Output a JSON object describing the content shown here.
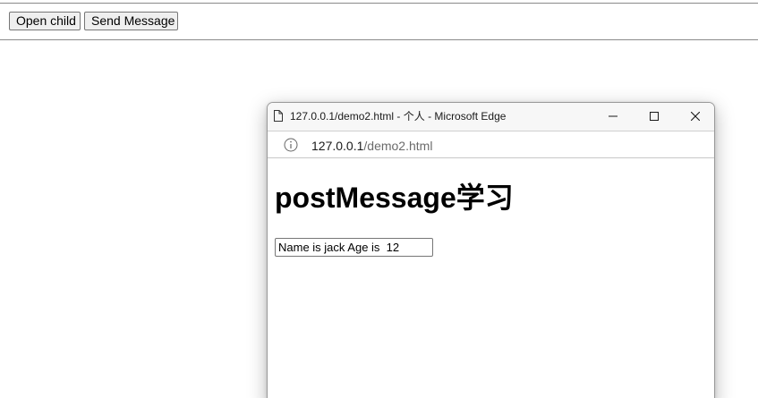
{
  "toolbar": {
    "open_child_label": "Open child",
    "send_message_label": "Send Message"
  },
  "popup": {
    "title": "127.0.0.1/demo2.html - 个人 - Microsoft Edge",
    "controls": {
      "minimize_icon": "minimize-icon",
      "maximize_icon": "maximize-icon",
      "close_icon": "close-icon"
    },
    "address": {
      "host": "127.0.0.1",
      "path": "/demo2.html",
      "info_icon": "info-icon"
    },
    "page": {
      "heading": "postMessage学习",
      "input_value": "Name is jack Age is  12"
    }
  },
  "colors": {
    "button_bg": "#efefef",
    "button_border": "#767676",
    "titlebar_bg": "#f7f7f7",
    "url_path": "#6b6b6b"
  }
}
